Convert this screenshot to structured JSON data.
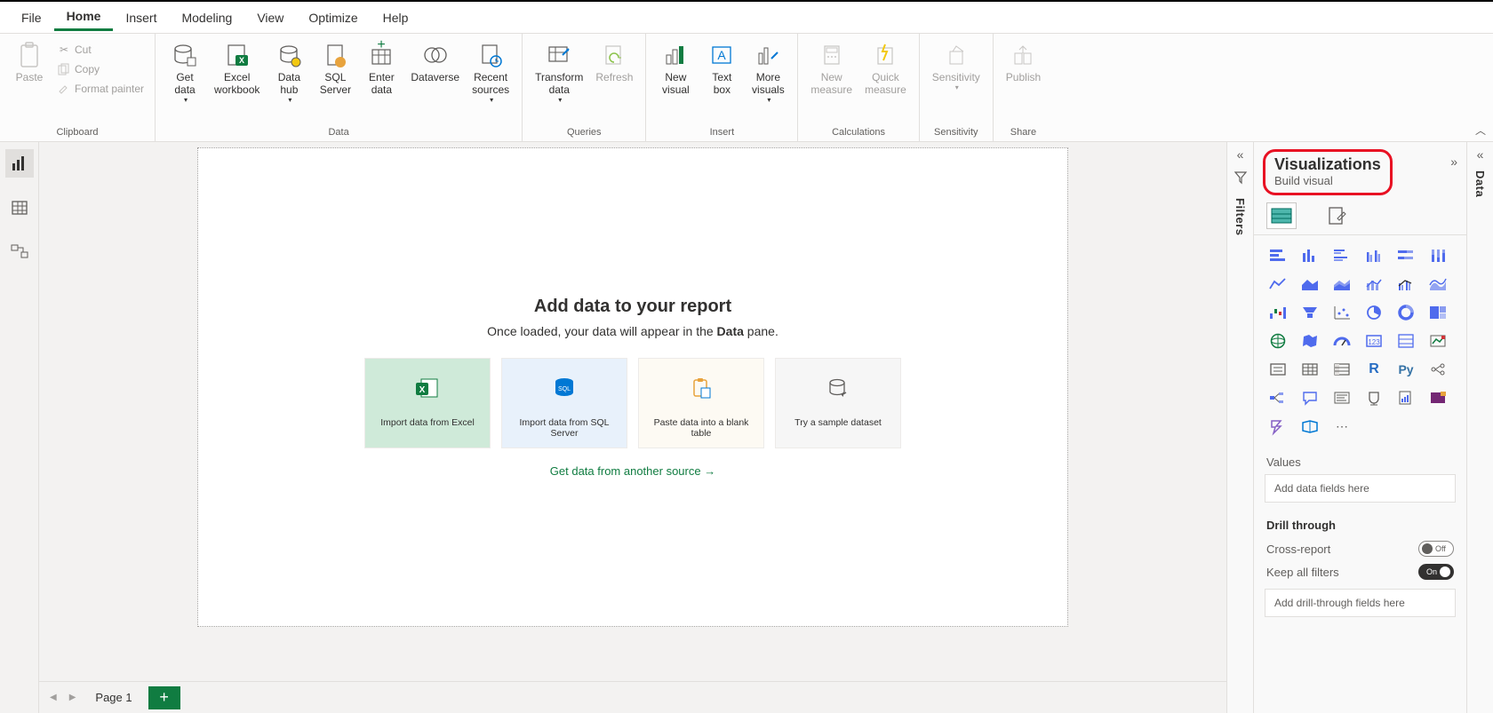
{
  "tabs": {
    "file": "File",
    "home": "Home",
    "insert": "Insert",
    "modeling": "Modeling",
    "view": "View",
    "optimize": "Optimize",
    "help": "Help"
  },
  "ribbon": {
    "clipboard": {
      "paste": "Paste",
      "cut": "Cut",
      "copy": "Copy",
      "format_painter": "Format painter",
      "group": "Clipboard"
    },
    "data": {
      "get_data": "Get\ndata",
      "excel": "Excel\nworkbook",
      "data_hub": "Data\nhub",
      "sql": "SQL\nServer",
      "enter": "Enter\ndata",
      "dataverse": "Dataverse",
      "recent": "Recent\nsources",
      "group": "Data"
    },
    "queries": {
      "transform": "Transform\ndata",
      "refresh": "Refresh",
      "group": "Queries"
    },
    "insert": {
      "new_visual": "New\nvisual",
      "text_box": "Text\nbox",
      "more_visuals": "More\nvisuals",
      "group": "Insert"
    },
    "calculations": {
      "new_measure": "New\nmeasure",
      "quick_measure": "Quick\nmeasure",
      "group": "Calculations"
    },
    "sensitivity": {
      "label": "Sensitivity",
      "group": "Sensitivity"
    },
    "share": {
      "publish": "Publish",
      "group": "Share"
    }
  },
  "canvas": {
    "title": "Add data to your report",
    "subtitle_pre": "Once loaded, your data will appear in the ",
    "subtitle_bold": "Data",
    "subtitle_post": " pane.",
    "cards": {
      "excel": "Import data from Excel",
      "sql": "Import data from SQL Server",
      "paste": "Paste data into a blank table",
      "sample": "Try a sample dataset"
    },
    "link": "Get data from another source →"
  },
  "page_tabs": {
    "page1": "Page 1"
  },
  "filters_pane": {
    "label": "Filters"
  },
  "viz_pane": {
    "title": "Visualizations",
    "subtitle": "Build visual",
    "values_label": "Values",
    "values_placeholder": "Add data fields here",
    "drill_label": "Drill through",
    "cross_report": "Cross-report",
    "cross_report_state": "Off",
    "keep_filters": "Keep all filters",
    "keep_filters_state": "On",
    "drill_placeholder": "Add drill-through fields here"
  },
  "data_pane": {
    "label": "Data"
  }
}
